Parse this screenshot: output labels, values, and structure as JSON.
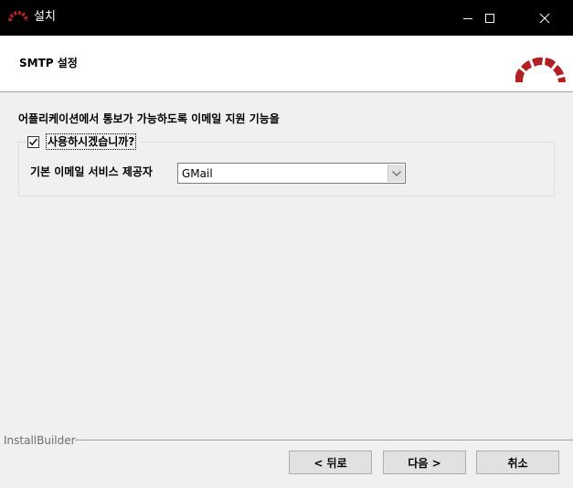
{
  "window": {
    "title": "설치",
    "controls": [
      "minimize",
      "maximize",
      "close"
    ]
  },
  "header": {
    "title": "SMTP 설정",
    "logo_icon": "redmine-logo-icon",
    "logo_color": "#b32024"
  },
  "main": {
    "intro": "어플리케이션에서 통보가 가능하도록 이메일 지원 기능을",
    "enable_checkbox": {
      "label": "사용하시겠습니까?",
      "checked": true
    },
    "provider": {
      "label": "기본 이메일 서비스 제공자",
      "selected": "GMail"
    }
  },
  "footer": {
    "brand": "InstallBuilder",
    "back_label": "< 뒤로",
    "next_label": "다음 >",
    "cancel_label": "취소"
  }
}
